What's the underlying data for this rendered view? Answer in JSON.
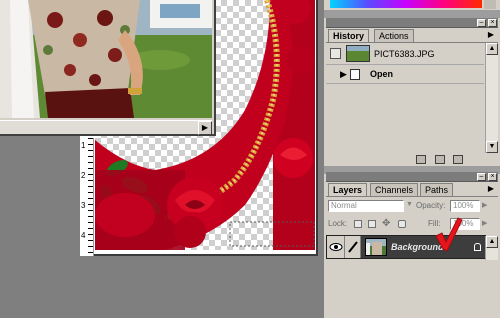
{
  "ruler": {
    "numbers": [
      "1",
      "2",
      "3",
      "4"
    ]
  },
  "document_front": {
    "scroll_right_arrow": "▶"
  },
  "history_panel": {
    "tabs": [
      {
        "label": "History",
        "active": true
      },
      {
        "label": "Actions",
        "active": false
      }
    ],
    "snapshot_name": "PICT6383.JPG",
    "steps": [
      {
        "label": "Open",
        "selected": true
      }
    ],
    "menu_arrow": "▶"
  },
  "layers_panel": {
    "tabs": [
      {
        "label": "Layers",
        "active": true
      },
      {
        "label": "Channels",
        "active": false
      },
      {
        "label": "Paths",
        "active": false
      }
    ],
    "blend_mode": "Normal",
    "opacity_label": "Opacity:",
    "opacity_value": "100%",
    "lock_label": "Lock:",
    "fill_label": "Fill:",
    "fill_value": "100%",
    "layer_name": "Background",
    "menu_arrow": "▶"
  },
  "annotation": {
    "checkmark_color": "#e8141c"
  },
  "colors": {
    "selected_row": "#3d3d3d",
    "panel": "#d4d0c8",
    "workspace": "#7f7f7f"
  }
}
